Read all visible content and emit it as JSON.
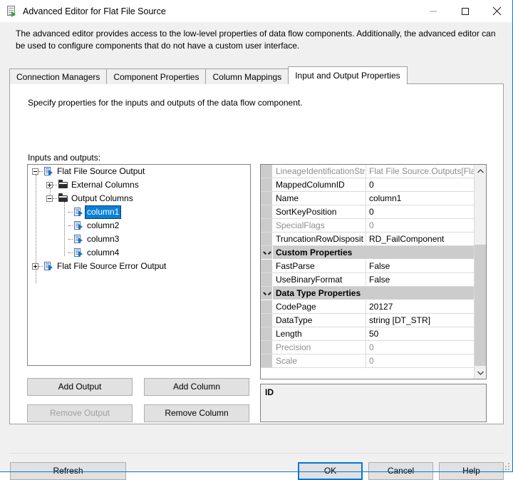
{
  "window": {
    "title": "Advanced Editor for Flat File Source",
    "icon": "flat-file-source-icon",
    "minimize_label": "—",
    "maximize_label": "□",
    "close_label": "✕"
  },
  "description": "The advanced editor provides access to the low-level properties of data flow components. Additionally, the advanced editor can be used to configure components that do not have a custom user interface.",
  "tabs": [
    {
      "label": "Connection Managers",
      "active": false
    },
    {
      "label": "Component Properties",
      "active": false
    },
    {
      "label": "Column Mappings",
      "active": false
    },
    {
      "label": "Input and Output Properties",
      "active": true
    }
  ],
  "panel": {
    "instruction": "Specify properties for the inputs and outputs of the data flow component.",
    "tree_label": "Inputs and outputs:"
  },
  "tree": {
    "nodes": [
      {
        "label": "Flat File Source Output",
        "icon": "output-icon",
        "expander": "minus",
        "depth": 0,
        "selected": false
      },
      {
        "label": "External Columns",
        "icon": "folder-icon",
        "expander": "plus",
        "depth": 1,
        "selected": false
      },
      {
        "label": "Output Columns",
        "icon": "folder-icon",
        "expander": "minus",
        "depth": 1,
        "selected": false
      },
      {
        "label": "column1",
        "icon": "column-icon",
        "expander": "none",
        "depth": 2,
        "selected": true
      },
      {
        "label": "column2",
        "icon": "column-icon",
        "expander": "none",
        "depth": 2,
        "selected": false
      },
      {
        "label": "column3",
        "icon": "column-icon",
        "expander": "none",
        "depth": 2,
        "selected": false
      },
      {
        "label": "column4",
        "icon": "column-icon",
        "expander": "none",
        "depth": 2,
        "selected": false
      },
      {
        "label": "Flat File Source Error Output",
        "icon": "output-icon",
        "expander": "plus",
        "depth": 0,
        "selected": false
      }
    ]
  },
  "tree_buttons": {
    "add_output": "Add Output",
    "add_column": "Add Column",
    "remove_output": "Remove Output",
    "remove_column": "Remove Column"
  },
  "property_grid": {
    "rows": [
      {
        "kind": "prop",
        "name": "LineageIdentificationStr",
        "value": "Flat File Source.Outputs[Flat",
        "dim": true
      },
      {
        "kind": "prop",
        "name": "MappedColumnID",
        "value": "0",
        "dim": false
      },
      {
        "kind": "prop",
        "name": "Name",
        "value": "column1",
        "dim": false
      },
      {
        "kind": "prop",
        "name": "SortKeyPosition",
        "value": "0",
        "dim": false
      },
      {
        "kind": "prop",
        "name": "SpecialFlags",
        "value": "0",
        "dim": true
      },
      {
        "kind": "prop",
        "name": "TruncationRowDisposit",
        "value": "RD_FailComponent",
        "dim": false
      },
      {
        "kind": "group",
        "name": "Custom Properties",
        "value": "",
        "dim": false
      },
      {
        "kind": "prop",
        "name": "FastParse",
        "value": "False",
        "dim": false
      },
      {
        "kind": "prop",
        "name": "UseBinaryFormat",
        "value": "False",
        "dim": false
      },
      {
        "kind": "group",
        "name": "Data Type Properties",
        "value": "",
        "dim": false
      },
      {
        "kind": "prop",
        "name": "CodePage",
        "value": "20127",
        "dim": false
      },
      {
        "kind": "prop",
        "name": "DataType",
        "value": "string [DT_STR]",
        "dim": false
      },
      {
        "kind": "prop",
        "name": "Length",
        "value": "50",
        "dim": false
      },
      {
        "kind": "prop",
        "name": "Precision",
        "value": "0",
        "dim": true
      },
      {
        "kind": "prop",
        "name": "Scale",
        "value": "0",
        "dim": true
      }
    ]
  },
  "description_box": {
    "title": "ID",
    "text": ""
  },
  "footer": {
    "refresh": "Refresh",
    "ok": "OK",
    "cancel": "Cancel",
    "help": "Help"
  },
  "colors": {
    "accent": "#0078d7",
    "selection": "#0a7fd6",
    "group_header": "#cccccc",
    "dialog_bg": "#f0f0f0"
  }
}
